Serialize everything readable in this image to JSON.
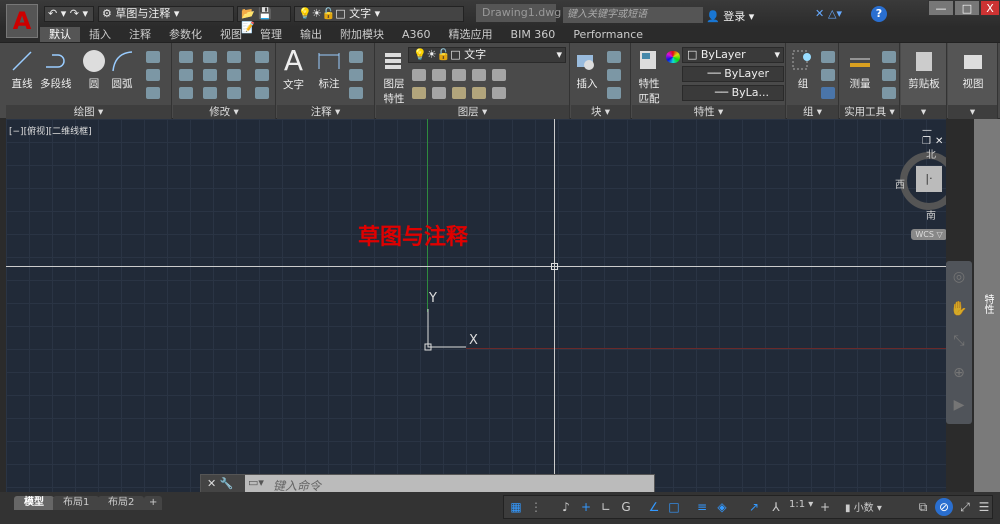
{
  "app": {
    "logo_letter": "A",
    "workspace": "草图与注释",
    "layer_current": "文字",
    "document": "Drawing1.dwg",
    "search_placeholder": "键入关键字或短语",
    "login": "登录",
    "help": "?"
  },
  "window_buttons": [
    "—",
    "□",
    "X"
  ],
  "ribbon_tabs": [
    "默认",
    "插入",
    "注释",
    "参数化",
    "视图",
    "管理",
    "输出",
    "附加模块",
    "A360",
    "精选应用",
    "BIM 360",
    "Performance"
  ],
  "panels": {
    "draw": {
      "title": "绘图",
      "tools": [
        "直线",
        "多段线",
        "圆",
        "圆弧"
      ]
    },
    "modify": {
      "title": "修改"
    },
    "annotation": {
      "title": "注释",
      "tools": [
        "文字",
        "标注"
      ]
    },
    "layers": {
      "title": "图层",
      "tool": "图层特性",
      "layer": "文字"
    },
    "block": {
      "title": "块",
      "tool": "插入"
    },
    "properties": {
      "title": "特性",
      "tool": "特性匹配",
      "color": "ByLayer",
      "linetype": "ByLayer",
      "lineweight": "ByLa..."
    },
    "groups": {
      "title": "组",
      "tool": "组"
    },
    "utilities": {
      "title": "实用工具",
      "tool": "测量"
    },
    "clipboard": {
      "title": "剪贴板"
    },
    "view": {
      "title": "视图"
    }
  },
  "viewport": {
    "label": "[−][俯视][二维线框]",
    "annotation_text": "草图与注释",
    "ucs_x": "X",
    "ucs_y": "Y",
    "controls": [
      "—",
      "❐",
      "✕"
    ]
  },
  "viewcube": {
    "north": "北",
    "south": "南",
    "east": "东",
    "west": "西",
    "wcs": "WCS ▽"
  },
  "side_palette": "特性",
  "command_line": {
    "placeholder": "键入命令"
  },
  "layout_tabs": [
    "模型",
    "布局1",
    "布局2",
    "+"
  ],
  "status": {
    "scale": "1:1",
    "units": "小数"
  },
  "colors": {
    "canvas": "#212a38",
    "accent_red": "#e00000",
    "status_blue": "#3399ff"
  }
}
